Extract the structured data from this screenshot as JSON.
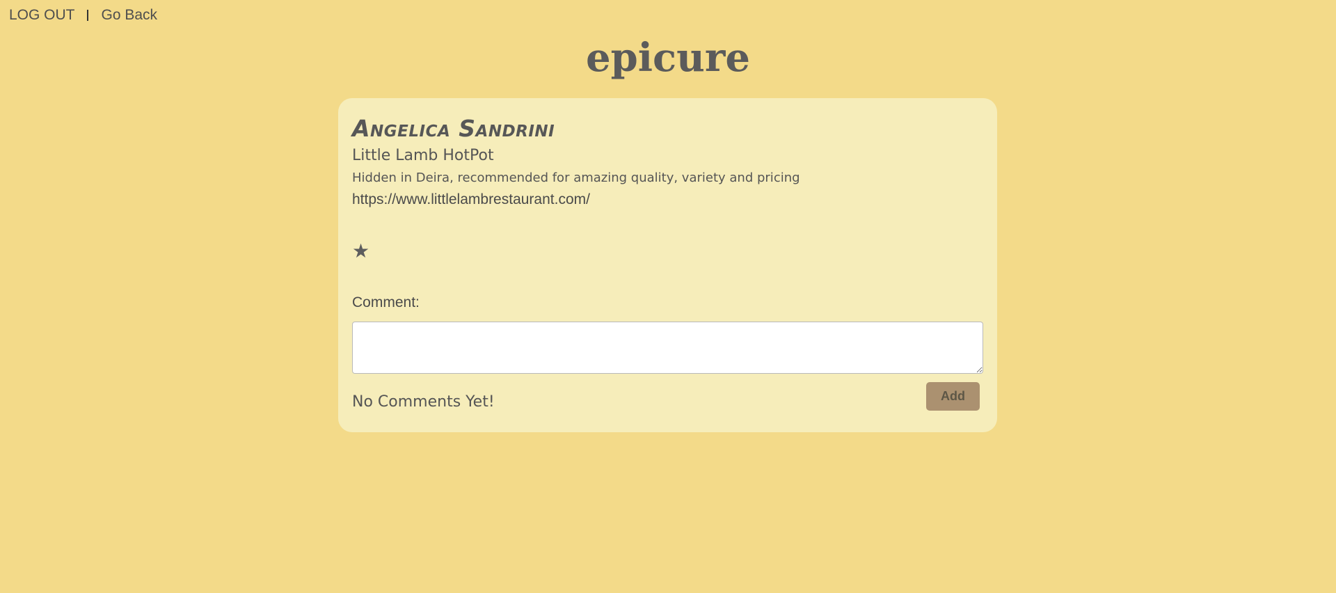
{
  "nav": {
    "logout_label": "LOG OUT",
    "separator": "I",
    "back_label": "Go Back"
  },
  "header": {
    "title": "epicure"
  },
  "post": {
    "author": "Angelica Sandrini",
    "restaurant": "Little Lamb HotPot",
    "description": "Hidden in Deira, recommended for amazing quality, variety and pricing",
    "url": "https://www.littlelambrestaurant.com/",
    "rating_display": "★",
    "rating_value": 1
  },
  "comments": {
    "label": "Comment:",
    "input_value": "",
    "add_label": "Add",
    "empty_message": "No Comments Yet!"
  },
  "colors": {
    "background": "#f3da89",
    "card": "#f6edba",
    "button": "#ab9170",
    "text": "#5d5d5d"
  }
}
